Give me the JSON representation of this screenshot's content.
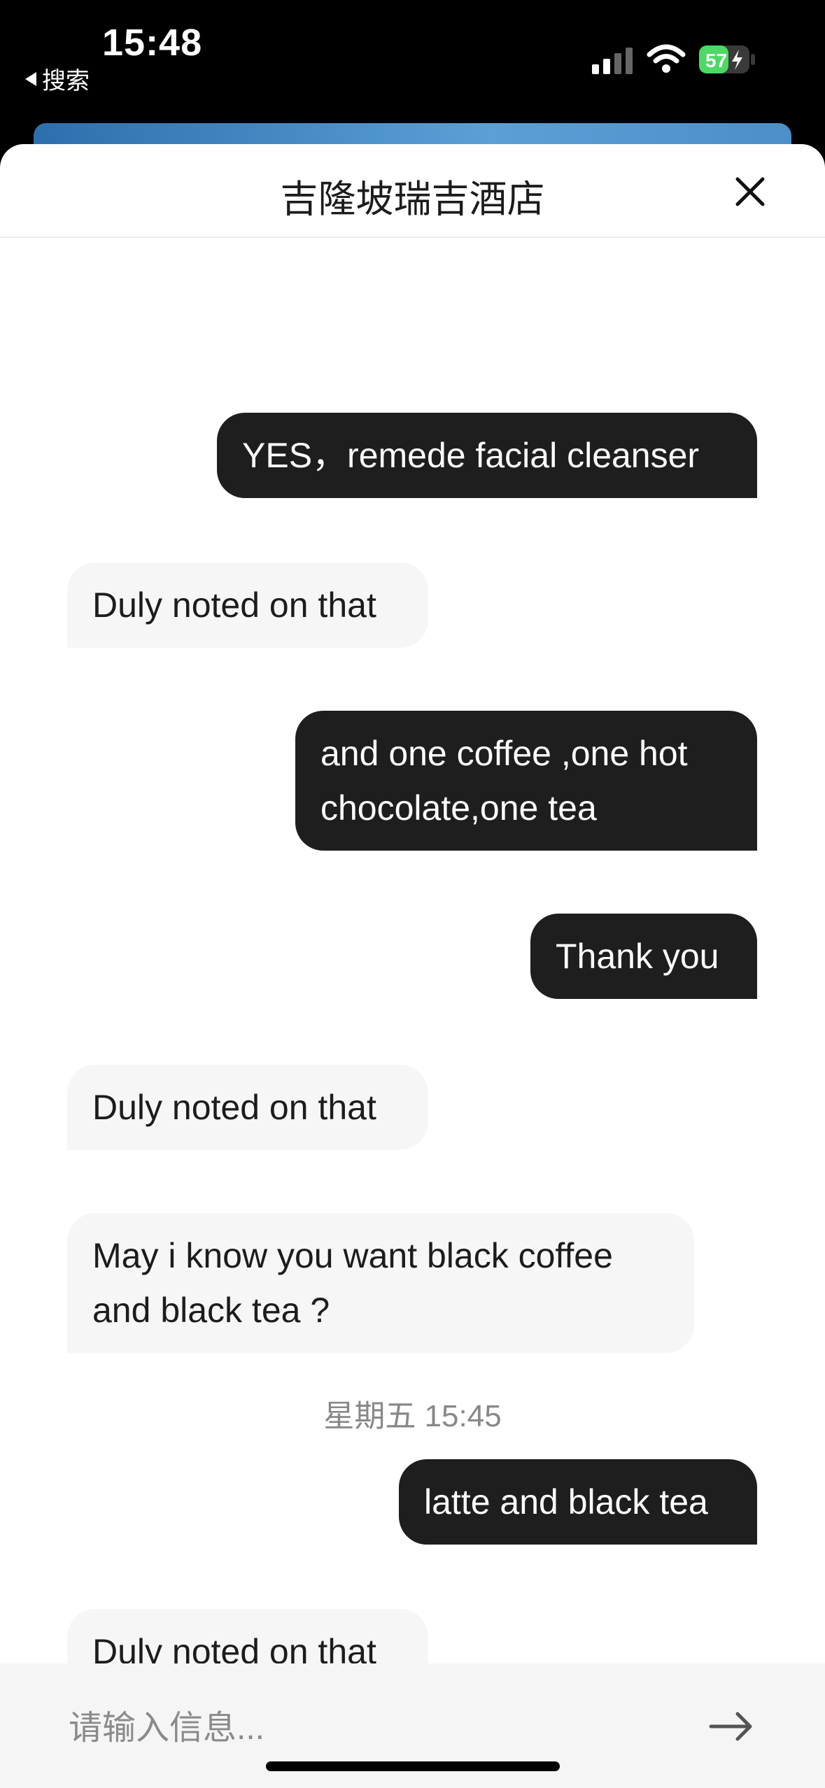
{
  "status_bar": {
    "time": "15:48",
    "back_app": "搜索",
    "battery": "57"
  },
  "header": {
    "title": "吉隆坡瑞吉酒店"
  },
  "messages": [
    {
      "direction": "out",
      "text": "YES，remede facial cleanser"
    },
    {
      "direction": "in",
      "text": "Duly noted on that"
    },
    {
      "direction": "out",
      "text": "and one coffee ,one hot chocolate,one tea"
    },
    {
      "direction": "out",
      "text": "Thank you"
    },
    {
      "direction": "in",
      "text": "Duly noted on that"
    },
    {
      "direction": "in",
      "text": "May i know you want black coffee and black tea ?"
    },
    {
      "direction": "out",
      "text": "latte and black tea"
    },
    {
      "direction": "in",
      "text": "Duly noted on that"
    }
  ],
  "timestamp": "星期五 15:45",
  "input": {
    "placeholder": "请输入信息..."
  },
  "colors": {
    "outgoing_bubble": "#1e1e1e",
    "incoming_bubble": "#f6f6f6",
    "battery_green": "#4cd964"
  }
}
